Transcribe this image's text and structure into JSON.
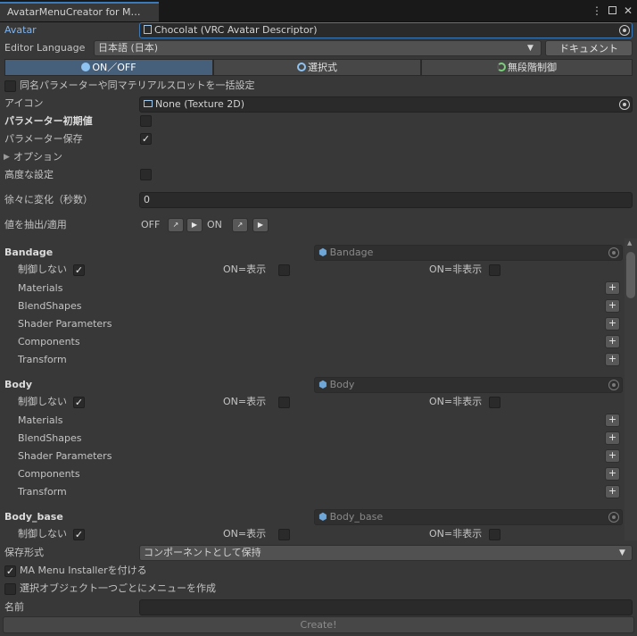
{
  "window": {
    "tab_title": "AvatarMenuCreator for M…",
    "icons": [
      "kebab-menu-icon",
      "maximize-icon",
      "close-icon"
    ]
  },
  "avatar": {
    "label": "Avatar",
    "value": "Chocolat (VRC Avatar Descriptor)"
  },
  "language": {
    "label": "Editor Language",
    "value": "日本語 (日本)",
    "doc_button": "ドキュメント"
  },
  "modes": [
    {
      "label": "ON／OFF",
      "icon": "toggle-icon",
      "active": true
    },
    {
      "label": "選択式",
      "icon": "select-icon",
      "active": false
    },
    {
      "label": "無段階制御",
      "icon": "radial-icon",
      "active": false
    }
  ],
  "bulk_setting": {
    "label": "同名パラメーターや同マテリアルスロットを一括設定",
    "checked": false
  },
  "icon_field": {
    "label": "アイコン",
    "value": "None (Texture 2D)"
  },
  "param_default": {
    "label": "パラメーター初期値",
    "checked": false
  },
  "param_save": {
    "label": "パラメーター保存",
    "checked": true
  },
  "options": {
    "label": "オプション"
  },
  "advanced": {
    "label": "高度な設定",
    "checked": false
  },
  "transition": {
    "label": "徐々に変化（秒数）",
    "value": "0"
  },
  "extract": {
    "label": "値を抽出/適用",
    "off": "OFF",
    "on": "ON"
  },
  "objects": [
    {
      "name": "Bandage",
      "field": "Bandage",
      "no_control": "制御しない",
      "on_show": "ON=表示",
      "on_hide": "ON=非表示",
      "no_control_checked": true,
      "on_show_checked": false,
      "on_hide_checked": false,
      "subs": [
        "Materials",
        "BlendShapes",
        "Shader Parameters",
        "Components",
        "Transform"
      ]
    },
    {
      "name": "Body",
      "field": "Body",
      "no_control": "制御しない",
      "on_show": "ON=表示",
      "on_hide": "ON=非表示",
      "no_control_checked": true,
      "on_show_checked": false,
      "on_hide_checked": false,
      "subs": [
        "Materials",
        "BlendShapes",
        "Shader Parameters",
        "Components",
        "Transform"
      ]
    },
    {
      "name": "Body_base",
      "field": "Body_base",
      "no_control": "制御しない",
      "on_show": "ON=表示",
      "on_hide": "ON=非表示",
      "no_control_checked": true,
      "on_show_checked": false,
      "on_hide_checked": false,
      "subs": []
    }
  ],
  "save_format": {
    "label": "保存形式",
    "value": "コンポーネントとして保持"
  },
  "ma_installer": {
    "label": "MA Menu Installerを付ける",
    "checked": true
  },
  "per_object": {
    "label": "選択オブジェクト一つごとにメニューを作成",
    "checked": false
  },
  "name_field": {
    "label": "名前",
    "value": ""
  },
  "create_button": "Create!",
  "colors": {
    "background": "#383838",
    "accent": "#46607c",
    "field": "#2a2a2a"
  }
}
